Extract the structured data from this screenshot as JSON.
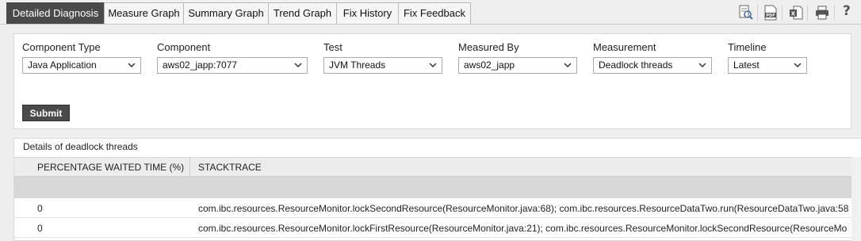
{
  "tabs": [
    {
      "label": "Detailed Diagnosis",
      "active": true
    },
    {
      "label": "Measure Graph",
      "active": false
    },
    {
      "label": "Summary Graph",
      "active": false
    },
    {
      "label": "Trend Graph",
      "active": false
    },
    {
      "label": "Fix History",
      "active": false
    },
    {
      "label": "Fix Feedback",
      "active": false
    }
  ],
  "toolbar": {
    "icons": [
      "search-report-icon",
      "pdf-icon",
      "excel-icon",
      "print-icon",
      "help-icon"
    ],
    "help_label": "?"
  },
  "filters": {
    "component_type": {
      "label": "Component Type",
      "value": "Java Application"
    },
    "component": {
      "label": "Component",
      "value": "aws02_japp:7077"
    },
    "test": {
      "label": "Test",
      "value": "JVM Threads"
    },
    "measured_by": {
      "label": "Measured By",
      "value": "aws02_japp"
    },
    "measurement": {
      "label": "Measurement",
      "value": "Deadlock threads"
    },
    "timeline": {
      "label": "Timeline",
      "value": "Latest"
    },
    "submit_label": "Submit"
  },
  "details": {
    "title": "Details of deadlock threads",
    "columns": [
      "PERCENTAGE WAITED TIME (%)",
      "STACKTRACE"
    ],
    "rows": [
      {
        "percentage": "0",
        "stacktrace": "com.ibc.resources.ResourceMonitor.lockSecondResource(ResourceMonitor.java:68); com.ibc.resources.ResourceDataTwo.run(ResourceDataTwo.java:58"
      },
      {
        "percentage": "0",
        "stacktrace": "com.ibc.resources.ResourceMonitor.lockFirstResource(ResourceMonitor.java:21); com.ibc.resources.ResourceMonitor.lockSecondResource(ResourceMo"
      }
    ]
  },
  "colors": {
    "active_tab": "#4a4a4a",
    "submit_button": "#4a4a4a",
    "table_header": "#ececec",
    "gray_band": "#d7d7d7"
  }
}
